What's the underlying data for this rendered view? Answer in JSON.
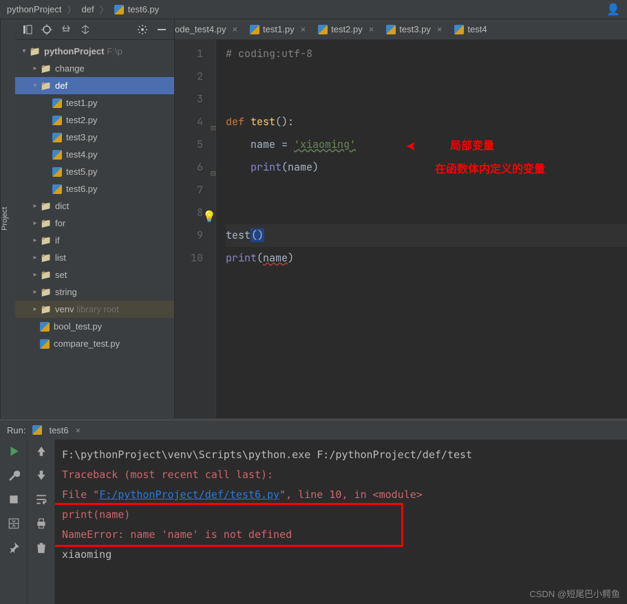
{
  "breadcrumb": {
    "project": "pythonProject",
    "folder": "def",
    "file": "test6.py"
  },
  "side_label": "Project",
  "tree": {
    "root": {
      "name": "pythonProject",
      "path": "F:\\p"
    },
    "change": "change",
    "def": "def",
    "files": [
      "test1.py",
      "test2.py",
      "test3.py",
      "test4.py",
      "test5.py",
      "test6.py"
    ],
    "dirs": [
      "dict",
      "for",
      "if",
      "list",
      "set",
      "string"
    ],
    "venv": {
      "name": "venv",
      "hint": "library root"
    },
    "loose": [
      "bool_test.py",
      "compare_test.py"
    ]
  },
  "tabs": [
    "ode_test4.py",
    "test1.py",
    "test2.py",
    "test3.py",
    "test4"
  ],
  "code": {
    "lines": [
      "1",
      "2",
      "3",
      "4",
      "5",
      "6",
      "7",
      "8",
      "9",
      "10"
    ],
    "l1": "# coding:utf-8",
    "l4_def": "def ",
    "l4_fn": "test",
    "l4_rest": "():",
    "l5_pre": "    name = ",
    "l5_str": "'xiaoming'",
    "l6_pre": "    ",
    "l6_print": "print",
    "l6_rest": "(name)",
    "l9_call": "test",
    "l9_par": "()",
    "l10_print": "print",
    "l10_name": "name"
  },
  "annotations": {
    "a1": "局部变量",
    "a2": "在函数体内定义的变量"
  },
  "run": {
    "label": "Run:",
    "name": "test6",
    "line1": "F:\\pythonProject\\venv\\Scripts\\python.exe F:/pythonProject/def/test",
    "line2": "Traceback (most recent call last):",
    "line3a": "  File \"",
    "line3link": "F:/pythonProject/def/test6.py",
    "line3b": "\", line 10, in <module>",
    "line4": "    print(name)",
    "line5": "NameError: name 'name' is not defined",
    "line6": "xiaoming"
  },
  "watermark": "CSDN @短尾巴小鳄鱼"
}
